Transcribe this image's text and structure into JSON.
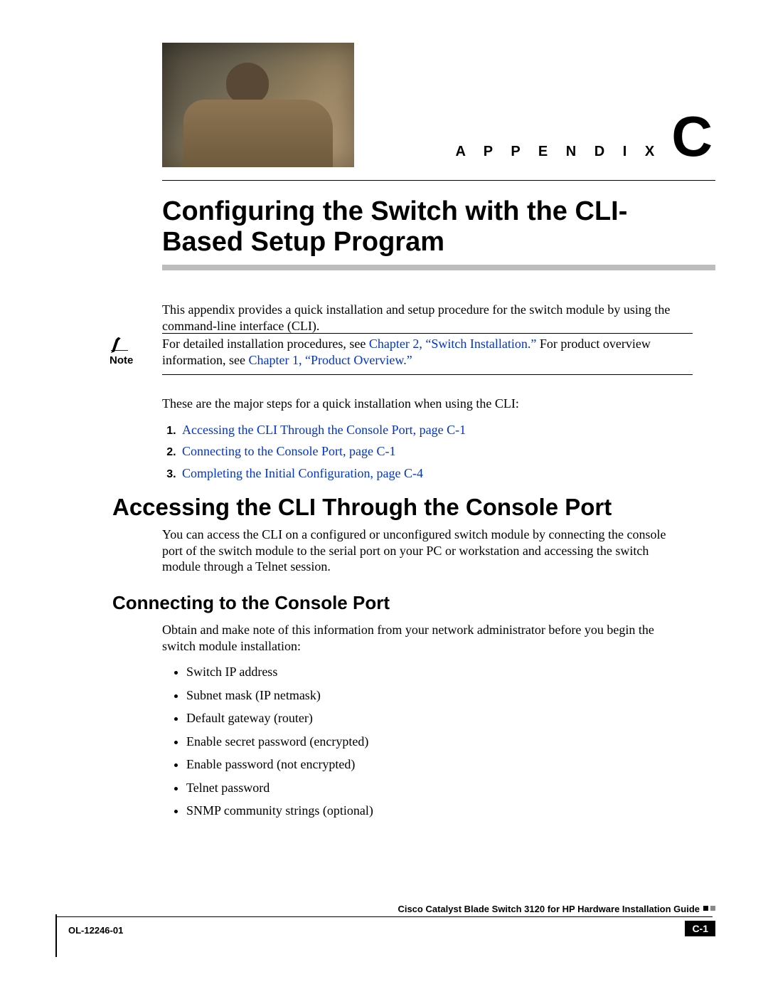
{
  "appendix": {
    "label": "A P P E N D I X",
    "letter": "C"
  },
  "title": "Configuring the Switch with the CLI-Based Setup Program",
  "intro": "This appendix provides a quick installation and setup procedure for the switch module by using the command-line interface (CLI).",
  "note": {
    "label": "Note",
    "before_link1": "For detailed installation procedures, see ",
    "link1": "Chapter 2, “Switch Installation.”",
    "between": " For product overview information, see ",
    "link2": "Chapter 1, “Product Overview.”"
  },
  "steps_intro": "These are the major steps for a quick installation when using the CLI:",
  "steps": [
    "Accessing the CLI Through the Console Port, page C-1",
    "Connecting to the Console Port, page C-1",
    "Completing the Initial Configuration, page C-4"
  ],
  "h1": "Accessing the CLI Through the Console Port",
  "h1_body": "You can access the CLI on a configured or unconfigured switch module by connecting the console port of the switch module to the serial port on your PC or workstation and accessing the switch module through a Telnet session.",
  "h2": "Connecting to the Console Port",
  "h2_body": "Obtain and make note of this information from your network administrator before you begin the switch module installation:",
  "bullets": [
    "Switch IP address",
    "Subnet mask (IP netmask)",
    "Default gateway (router)",
    "Enable secret password (encrypted)",
    "Enable password (not encrypted)",
    "Telnet password",
    "SNMP community strings (optional)"
  ],
  "footer": {
    "guide": "Cisco Catalyst Blade Switch 3120 for HP Hardware Installation Guide",
    "docnum": "OL-12246-01",
    "page": "C-1"
  }
}
